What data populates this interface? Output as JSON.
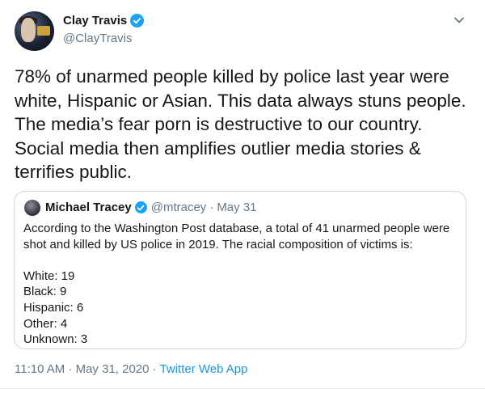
{
  "author": {
    "name": "Clay Travis",
    "handle": "@ClayTravis",
    "avatar_icon": "profile-photo"
  },
  "tweet": {
    "lines": [
      "78% of unarmed people killed by police last year were",
      "white, Hispanic or Asian. This data always stuns people.",
      "The media’s fear porn is destructive to our country.",
      "Social media then amplifies outlier media stories &",
      "terrifies public."
    ]
  },
  "quoted": {
    "name": "Michael Tracey",
    "handle": "@mtracey",
    "separator": "·",
    "date": "May 31",
    "intro_lines": [
      "According to the Washington Post database, a total of 41 unarmed people were",
      "shot and killed by US police in 2019. The racial composition of victims is:"
    ],
    "stats": [
      "White: 19",
      "Black: 9",
      "Hispanic: 6",
      "Other: 4",
      "Unknown: 3"
    ]
  },
  "footer": {
    "time_date": "11:10 AM · May 31, 2020 · ",
    "app": "Twitter Web App"
  },
  "colors": {
    "verified_blue": "#1da1f2",
    "link_blue": "#1b95e0",
    "secondary_gray": "#657786"
  }
}
